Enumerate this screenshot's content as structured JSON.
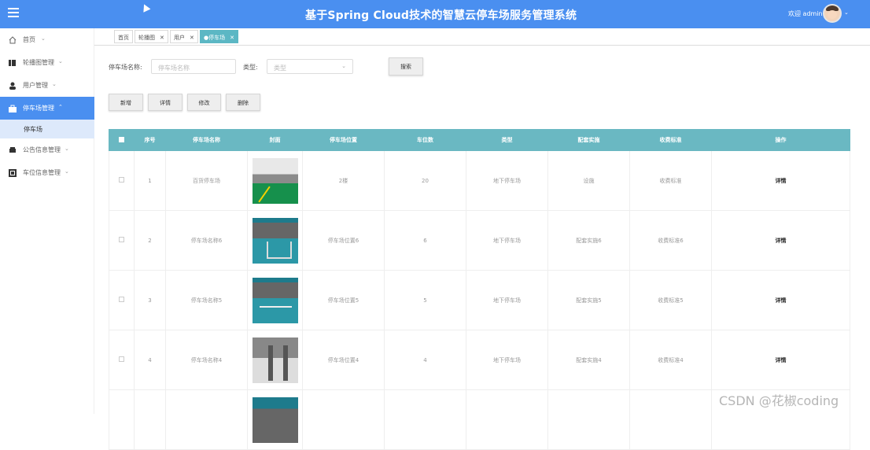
{
  "header": {
    "title": "基于Spring Cloud技术的智慧云停车场服务管理系统",
    "welcome": "欢迎 admin"
  },
  "sidebar": {
    "items": [
      {
        "label": "首页",
        "icon": "home-icon"
      },
      {
        "label": "轮播图管理",
        "icon": "carousel-icon"
      },
      {
        "label": "用户管理",
        "icon": "user-icon"
      },
      {
        "label": "停车场管理",
        "icon": "briefcase-icon"
      },
      {
        "label": "公告信息管理",
        "icon": "car-icon"
      },
      {
        "label": "车位信息管理",
        "icon": "grid-icon"
      }
    ],
    "subitem": "停车场"
  },
  "tabs": [
    {
      "label": "首页"
    },
    {
      "label": "轮播图",
      "close": "✕"
    },
    {
      "label": "用户",
      "close": "✕"
    },
    {
      "label": "●停车场",
      "close": "✕"
    }
  ],
  "search": {
    "name_label": "停车场名称:",
    "name_placeholder": "停车场名称",
    "type_label": "类型:",
    "type_placeholder": "类型",
    "search_button": "搜索"
  },
  "actions": {
    "add": "新增",
    "details": "详情",
    "edit": "修改",
    "delete": "删除"
  },
  "table": {
    "headers": [
      "序号",
      "停车场名称",
      "封面",
      "停车场位置",
      "车位数",
      "类型",
      "配套实施",
      "收费标准",
      "操作"
    ],
    "rows": [
      {
        "index": "1",
        "name": "百货停车场",
        "location": "2楼",
        "spaces": "20",
        "type": "地下停车场",
        "facilities": "设施",
        "fee": "收费标准",
        "action": "详情"
      },
      {
        "index": "2",
        "name": "停车场名称6",
        "location": "停车场位置6",
        "spaces": "6",
        "type": "地下停车场",
        "facilities": "配套实施6",
        "fee": "收费标准6",
        "action": "详情"
      },
      {
        "index": "3",
        "name": "停车场名称5",
        "location": "停车场位置5",
        "spaces": "5",
        "type": "地下停车场",
        "facilities": "配套实施5",
        "fee": "收费标准5",
        "action": "详情"
      },
      {
        "index": "4",
        "name": "停车场名称4",
        "location": "停车场位置4",
        "spaces": "4",
        "type": "地下停车场",
        "facilities": "配套实施4",
        "fee": "收费标准4",
        "action": "详情"
      },
      {
        "index": "",
        "name": "",
        "location": "",
        "spaces": "",
        "type": "",
        "facilities": "",
        "fee": "",
        "action": ""
      }
    ]
  },
  "watermark": "CSDN @花椒coding"
}
